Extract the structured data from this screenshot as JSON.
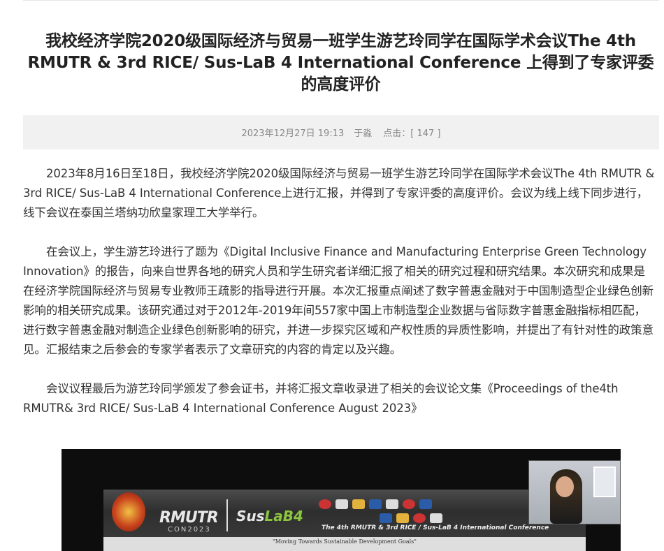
{
  "article": {
    "title": "我校经济学院2020级国际经济与贸易一班学生游艺玲同学在国际学术会议The 4th RMUTR & 3rd RICE/ Sus-LaB 4 International Conference 上得到了专家评委的高度评价",
    "meta": {
      "date": "2023年12月27日 19:13",
      "author": "于淼",
      "views_label": "点击：",
      "views_value": "[ 147 ]"
    },
    "paragraphs": [
      "2023年8月16日至18日，我校经济学院2020级国际经济与贸易一班学生游艺玲同学在国际学术会议The 4th RMUTR & 3rd RICE/ Sus-LaB 4 International Conference上进行汇报，并得到了专家评委的高度评价。会议为线上线下同步进行，线下会议在泰国兰塔纳功欣皇家理工大学举行。",
      "在会议上，学生游艺玲进行了题为《Digital Inclusive Finance and Manufacturing Enterprise Green Technology Innovation》的报告，向来自世界各地的研究人员和学生研究者详细汇报了相关的研究过程和研究结果。本次研究和成果是在经济学院国际经济与贸易专业教师王疏影的指导进行开展。本次汇报重点阐述了数字普惠金融对于中国制造型企业绿色创新影响的相关研究成果。该研究通过对于2012年-2019年间557家中国上市制造型企业数据与省际数字普惠金融指标相匹配，进行数字普惠金融对制造企业绿色创新影响的研究，并进一步探究区域和产权性质的异质性影响，并提出了有针对性的政策意见。汇报结束之后参会的专家学者表示了文章研究的内容的肯定以及兴趣。",
      "会议议程最后为游艺玲同学颁发了参会证书，并将汇报文章收录进了相关的会议论文集《Proceedings of the4th RMUTR& 3rd RICE/ Sus-LaB 4 International Conference August 2023》"
    ]
  },
  "figure": {
    "rmutr": "RMUTR",
    "rmutr_sub": "CON2023",
    "sus": "Sus",
    "lab": "LaB4",
    "caption": "The 4th RMUTR & 3rd RICE / Sus-LaB 4 International Conference",
    "slogan": "\"Moving Towards Sustainable Development Goals\""
  }
}
